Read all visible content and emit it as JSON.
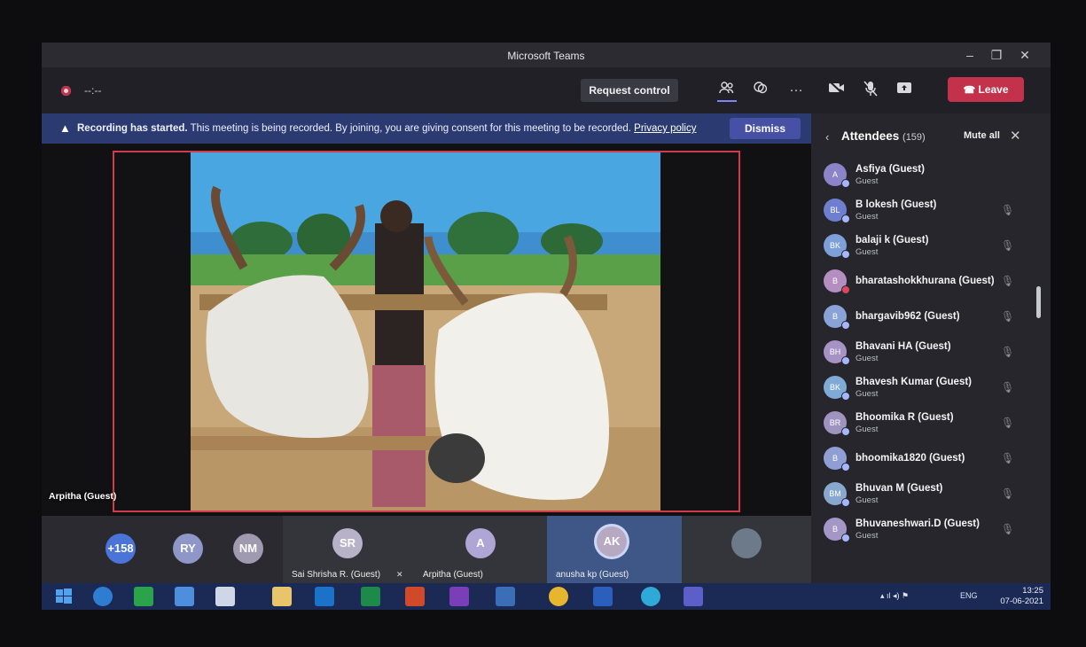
{
  "window": {
    "title": "Microsoft Teams"
  },
  "toolbar": {
    "timer": "--:--",
    "request_control": "Request control",
    "more": "···",
    "leave": "Leave",
    "icons": [
      "people-icon",
      "chat-icon",
      "more-icon",
      "camera-off-icon",
      "mic-off-icon",
      "share-icon",
      "phone-icon"
    ]
  },
  "banner": {
    "headline": "Recording has started.",
    "message": "This meeting is being recorded. By joining, you are giving consent for this meeting to be recorded.",
    "privacy_link": "Privacy policy",
    "dismiss": "Dismiss"
  },
  "stage": {
    "presenter_label": "Arpitha (Guest)"
  },
  "strip": {
    "overflow": "+158",
    "circles": [
      "RY",
      "NM"
    ],
    "tiles": [
      {
        "initials": "SR",
        "name": "Sai Shrisha R. (Guest)"
      },
      {
        "initials": "A",
        "name": "Arpitha (Guest)"
      },
      {
        "initials": "AK",
        "name": "anusha kp (Guest)"
      }
    ]
  },
  "roster": {
    "title": "Attendees",
    "count": "(159)",
    "mute_all": "Mute all",
    "people": [
      {
        "initials": "A",
        "name": "Asfiya (Guest)",
        "role": "Guest"
      },
      {
        "initials": "BL",
        "name": "B lokesh (Guest)",
        "role": "Guest"
      },
      {
        "initials": "BK",
        "name": "balaji k (Guest)",
        "role": "Guest"
      },
      {
        "initials": "B",
        "name": "bharatashokkhurana (Guest)",
        "role": ""
      },
      {
        "initials": "B",
        "name": "bhargavib962 (Guest)",
        "role": ""
      },
      {
        "initials": "BH",
        "name": "Bhavani HA (Guest)",
        "role": "Guest"
      },
      {
        "initials": "BK",
        "name": "Bhavesh Kumar (Guest)",
        "role": "Guest"
      },
      {
        "initials": "BR",
        "name": "Bhoomika R (Guest)",
        "role": "Guest"
      },
      {
        "initials": "B",
        "name": "bhoomika1820 (Guest)",
        "role": ""
      },
      {
        "initials": "BM",
        "name": "Bhuvan M (Guest)",
        "role": "Guest"
      },
      {
        "initials": "B",
        "name": "Bhuvaneshwari.D (Guest)",
        "role": "Guest"
      }
    ]
  },
  "taskbar": {
    "lang": "ENG",
    "time": "13:25",
    "date": "07-06-2021"
  },
  "colors": {
    "accent": "#7f85f5",
    "leave": "#c4314b",
    "banner": "#2c3a72"
  }
}
